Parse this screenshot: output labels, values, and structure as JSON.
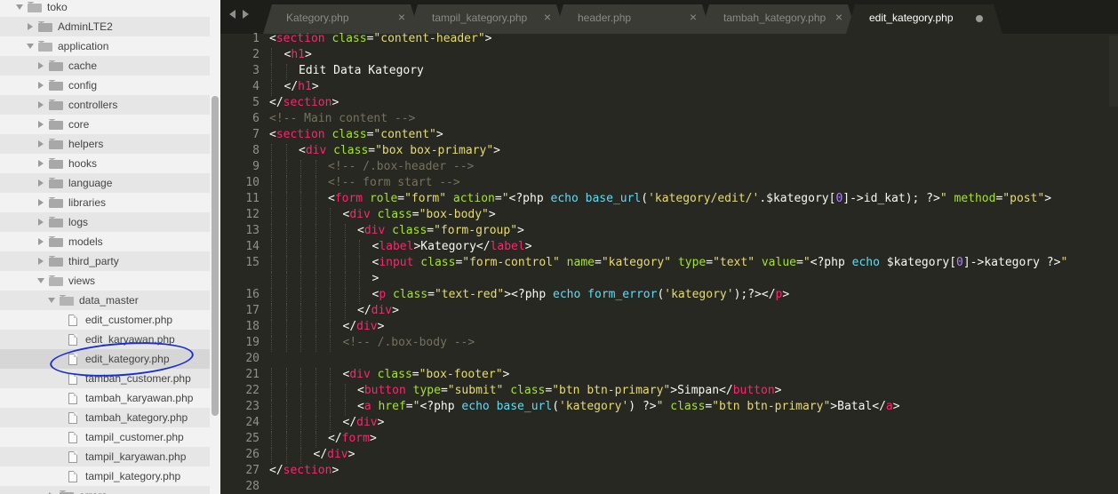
{
  "sidebar": {
    "items": [
      {
        "label": "toko",
        "depth": 0,
        "kind": "folder",
        "state": "open"
      },
      {
        "label": "AdminLTE2",
        "depth": 1,
        "kind": "folder",
        "state": "closed"
      },
      {
        "label": "application",
        "depth": 1,
        "kind": "folder",
        "state": "open"
      },
      {
        "label": "cache",
        "depth": 2,
        "kind": "folder",
        "state": "closed"
      },
      {
        "label": "config",
        "depth": 2,
        "kind": "folder",
        "state": "closed"
      },
      {
        "label": "controllers",
        "depth": 2,
        "kind": "folder",
        "state": "closed"
      },
      {
        "label": "core",
        "depth": 2,
        "kind": "folder",
        "state": "closed"
      },
      {
        "label": "helpers",
        "depth": 2,
        "kind": "folder",
        "state": "closed"
      },
      {
        "label": "hooks",
        "depth": 2,
        "kind": "folder",
        "state": "closed"
      },
      {
        "label": "language",
        "depth": 2,
        "kind": "folder",
        "state": "closed"
      },
      {
        "label": "libraries",
        "depth": 2,
        "kind": "folder",
        "state": "closed"
      },
      {
        "label": "logs",
        "depth": 2,
        "kind": "folder",
        "state": "closed"
      },
      {
        "label": "models",
        "depth": 2,
        "kind": "folder",
        "state": "closed"
      },
      {
        "label": "third_party",
        "depth": 2,
        "kind": "folder",
        "state": "closed"
      },
      {
        "label": "views",
        "depth": 2,
        "kind": "folder",
        "state": "open"
      },
      {
        "label": "data_master",
        "depth": 3,
        "kind": "folder",
        "state": "open"
      },
      {
        "label": "edit_customer.php",
        "depth": 4,
        "kind": "file"
      },
      {
        "label": "edit_karyawan.php",
        "depth": 4,
        "kind": "file"
      },
      {
        "label": "edit_kategory.php",
        "depth": 4,
        "kind": "file",
        "selected": true
      },
      {
        "label": "tambah_customer.php",
        "depth": 4,
        "kind": "file"
      },
      {
        "label": "tambah_karyawan.php",
        "depth": 4,
        "kind": "file"
      },
      {
        "label": "tambah_kategory.php",
        "depth": 4,
        "kind": "file"
      },
      {
        "label": "tampil_customer.php",
        "depth": 4,
        "kind": "file"
      },
      {
        "label": "tampil_karyawan.php",
        "depth": 4,
        "kind": "file"
      },
      {
        "label": "tampil_kategory.php",
        "depth": 4,
        "kind": "file"
      },
      {
        "label": "errors",
        "depth": 3,
        "kind": "folder",
        "state": "closed"
      }
    ]
  },
  "tabs": [
    {
      "label": "Kategory.php",
      "active": false,
      "close": "×"
    },
    {
      "label": "tampil_kategory.php",
      "active": false,
      "close": "×"
    },
    {
      "label": "header.php",
      "active": false,
      "close": "×"
    },
    {
      "label": "tambah_kategory.php",
      "active": false,
      "close": "×"
    },
    {
      "label": "edit_kategory.php",
      "active": true,
      "modified": true
    }
  ],
  "annotation_color": "#1a2fd0",
  "editor": {
    "theme_colors": {
      "tag": "#f92672",
      "attr": "#a6e22e",
      "string": "#e6db74",
      "comment": "#75715e",
      "keyword": "#66d9ef",
      "number": "#ae81ff",
      "text": "#f8f8f2",
      "background": "#272822"
    },
    "lines": [
      {
        "n": "1",
        "indent": 0,
        "tokens": [
          [
            "p",
            "<"
          ],
          [
            "t",
            "section"
          ],
          [
            "p",
            " "
          ],
          [
            "a",
            "class"
          ],
          [
            "p",
            "="
          ],
          [
            "s",
            "\"content-header\""
          ],
          [
            "p",
            ">"
          ]
        ]
      },
      {
        "n": "2",
        "indent": 1,
        "tokens": [
          [
            "p",
            "<"
          ],
          [
            "t",
            "h1"
          ],
          [
            "p",
            ">"
          ]
        ]
      },
      {
        "n": "3",
        "indent": 2,
        "tokens": [
          [
            "p",
            "Edit Data Kategory"
          ]
        ]
      },
      {
        "n": "4",
        "indent": 1,
        "tokens": [
          [
            "p",
            "</"
          ],
          [
            "t",
            "h1"
          ],
          [
            "p",
            ">"
          ]
        ]
      },
      {
        "n": "5",
        "indent": 0,
        "tokens": [
          [
            "p",
            "</"
          ],
          [
            "t",
            "section"
          ],
          [
            "p",
            ">"
          ]
        ]
      },
      {
        "n": "6",
        "indent": 0,
        "tokens": [
          [
            "c",
            "<!-- Main content -->"
          ]
        ]
      },
      {
        "n": "7",
        "indent": 0,
        "tokens": [
          [
            "p",
            "<"
          ],
          [
            "t",
            "section"
          ],
          [
            "p",
            " "
          ],
          [
            "a",
            "class"
          ],
          [
            "p",
            "="
          ],
          [
            "s",
            "\"content\""
          ],
          [
            "p",
            ">"
          ]
        ]
      },
      {
        "n": "8",
        "indent": 2,
        "tokens": [
          [
            "p",
            "<"
          ],
          [
            "t",
            "div"
          ],
          [
            "p",
            " "
          ],
          [
            "a",
            "class"
          ],
          [
            "p",
            "="
          ],
          [
            "s",
            "\"box box-primary\""
          ],
          [
            "p",
            ">"
          ]
        ]
      },
      {
        "n": "9",
        "indent": 4,
        "tokens": [
          [
            "c",
            "<!-- /.box-header -->"
          ]
        ]
      },
      {
        "n": "10",
        "indent": 4,
        "tokens": [
          [
            "c",
            "<!-- form start -->"
          ]
        ]
      },
      {
        "n": "11",
        "indent": 4,
        "tokens": [
          [
            "p",
            "<"
          ],
          [
            "t",
            "form"
          ],
          [
            "p",
            " "
          ],
          [
            "a",
            "role"
          ],
          [
            "p",
            "="
          ],
          [
            "s",
            "\"form\""
          ],
          [
            "p",
            " "
          ],
          [
            "a",
            "action"
          ],
          [
            "p",
            "="
          ],
          [
            "s",
            "\""
          ],
          [
            "p",
            "<?php "
          ],
          [
            "k",
            "echo"
          ],
          [
            "p",
            " "
          ],
          [
            "k",
            "base_url"
          ],
          [
            "p",
            "("
          ],
          [
            "s",
            "'kategory/edit/'"
          ],
          [
            "p",
            "."
          ],
          [
            "p",
            "$kategory"
          ],
          [
            "p",
            "["
          ],
          [
            "n",
            "0"
          ],
          [
            "p",
            "]->id_kat); ?>"
          ],
          [
            "s",
            "\""
          ],
          [
            "p",
            " "
          ],
          [
            "a",
            "method"
          ],
          [
            "p",
            "="
          ],
          [
            "s",
            "\"post\""
          ],
          [
            "p",
            ">"
          ]
        ]
      },
      {
        "n": "12",
        "indent": 5,
        "tokens": [
          [
            "p",
            "<"
          ],
          [
            "t",
            "div"
          ],
          [
            "p",
            " "
          ],
          [
            "a",
            "class"
          ],
          [
            "p",
            "="
          ],
          [
            "s",
            "\"box-body\""
          ],
          [
            "p",
            ">"
          ]
        ]
      },
      {
        "n": "13",
        "indent": 6,
        "tokens": [
          [
            "p",
            "<"
          ],
          [
            "t",
            "div"
          ],
          [
            "p",
            " "
          ],
          [
            "a",
            "class"
          ],
          [
            "p",
            "="
          ],
          [
            "s",
            "\"form-group\""
          ],
          [
            "p",
            ">"
          ]
        ]
      },
      {
        "n": "14",
        "indent": 7,
        "tokens": [
          [
            "p",
            "<"
          ],
          [
            "t",
            "label"
          ],
          [
            "p",
            ">Kategory</"
          ],
          [
            "t",
            "label"
          ],
          [
            "p",
            ">"
          ]
        ]
      },
      {
        "n": "15",
        "indent": 7,
        "tokens": [
          [
            "p",
            "<"
          ],
          [
            "t",
            "input"
          ],
          [
            "p",
            " "
          ],
          [
            "a",
            "class"
          ],
          [
            "p",
            "="
          ],
          [
            "s",
            "\"form-control\""
          ],
          [
            "p",
            " "
          ],
          [
            "a",
            "name"
          ],
          [
            "p",
            "="
          ],
          [
            "s",
            "\"kategory\""
          ],
          [
            "p",
            " "
          ],
          [
            "a",
            "type"
          ],
          [
            "p",
            "="
          ],
          [
            "s",
            "\"text\""
          ],
          [
            "p",
            " "
          ],
          [
            "a",
            "value"
          ],
          [
            "p",
            "="
          ],
          [
            "s",
            "\""
          ],
          [
            "p",
            "<?php "
          ],
          [
            "k",
            "echo"
          ],
          [
            "p",
            " $kategory["
          ],
          [
            "n",
            "0"
          ],
          [
            "p",
            "]->kategory ?>"
          ],
          [
            "s",
            "\""
          ]
        ]
      },
      {
        "n": "",
        "indent": 7,
        "tokens": [
          [
            "p",
            ">"
          ]
        ]
      },
      {
        "n": "16",
        "indent": 7,
        "tokens": [
          [
            "p",
            "<"
          ],
          [
            "t",
            "p"
          ],
          [
            "p",
            " "
          ],
          [
            "a",
            "class"
          ],
          [
            "p",
            "="
          ],
          [
            "s",
            "\"text-red\""
          ],
          [
            "p",
            "><?php "
          ],
          [
            "k",
            "echo"
          ],
          [
            "p",
            " "
          ],
          [
            "k",
            "form_error"
          ],
          [
            "p",
            "("
          ],
          [
            "s",
            "'kategory'"
          ],
          [
            "p",
            ");?></"
          ],
          [
            "t",
            "p"
          ],
          [
            "p",
            ">"
          ]
        ]
      },
      {
        "n": "17",
        "indent": 6,
        "tokens": [
          [
            "p",
            "</"
          ],
          [
            "t",
            "div"
          ],
          [
            "p",
            ">"
          ]
        ]
      },
      {
        "n": "18",
        "indent": 5,
        "tokens": [
          [
            "p",
            "</"
          ],
          [
            "t",
            "div"
          ],
          [
            "p",
            ">"
          ]
        ]
      },
      {
        "n": "19",
        "indent": 5,
        "tokens": [
          [
            "c",
            "<!-- /.box-body -->"
          ]
        ]
      },
      {
        "n": "20",
        "indent": 0,
        "tokens": []
      },
      {
        "n": "21",
        "indent": 5,
        "tokens": [
          [
            "p",
            "<"
          ],
          [
            "t",
            "div"
          ],
          [
            "p",
            " "
          ],
          [
            "a",
            "class"
          ],
          [
            "p",
            "="
          ],
          [
            "s",
            "\"box-footer\""
          ],
          [
            "p",
            ">"
          ]
        ]
      },
      {
        "n": "22",
        "indent": 6,
        "tokens": [
          [
            "p",
            "<"
          ],
          [
            "t",
            "button"
          ],
          [
            "p",
            " "
          ],
          [
            "a",
            "type"
          ],
          [
            "p",
            "="
          ],
          [
            "s",
            "\"submit\""
          ],
          [
            "p",
            " "
          ],
          [
            "a",
            "class"
          ],
          [
            "p",
            "="
          ],
          [
            "s",
            "\"btn btn-primary\""
          ],
          [
            "p",
            ">Simpan</"
          ],
          [
            "t",
            "button"
          ],
          [
            "p",
            ">"
          ]
        ]
      },
      {
        "n": "23",
        "indent": 6,
        "tokens": [
          [
            "p",
            "<"
          ],
          [
            "t",
            "a"
          ],
          [
            "p",
            " "
          ],
          [
            "a",
            "href"
          ],
          [
            "p",
            "="
          ],
          [
            "s",
            "\""
          ],
          [
            "p",
            "<?php "
          ],
          [
            "k",
            "echo"
          ],
          [
            "p",
            " "
          ],
          [
            "k",
            "base_url"
          ],
          [
            "p",
            "("
          ],
          [
            "s",
            "'kategory'"
          ],
          [
            "p",
            ") ?>"
          ],
          [
            "s",
            "\""
          ],
          [
            "p",
            " "
          ],
          [
            "a",
            "class"
          ],
          [
            "p",
            "="
          ],
          [
            "s",
            "\"btn btn-primary\""
          ],
          [
            "p",
            ">Batal</"
          ],
          [
            "t",
            "a"
          ],
          [
            "p",
            ">"
          ]
        ]
      },
      {
        "n": "24",
        "indent": 5,
        "tokens": [
          [
            "p",
            "</"
          ],
          [
            "t",
            "div"
          ],
          [
            "p",
            ">"
          ]
        ]
      },
      {
        "n": "25",
        "indent": 4,
        "tokens": [
          [
            "p",
            "</"
          ],
          [
            "t",
            "form"
          ],
          [
            "p",
            ">"
          ]
        ]
      },
      {
        "n": "26",
        "indent": 3,
        "tokens": [
          [
            "p",
            "</"
          ],
          [
            "t",
            "div"
          ],
          [
            "p",
            ">"
          ]
        ]
      },
      {
        "n": "27",
        "indent": 0,
        "tokens": [
          [
            "p",
            "</"
          ],
          [
            "t",
            "section"
          ],
          [
            "p",
            ">"
          ]
        ]
      },
      {
        "n": "28",
        "indent": 0,
        "tokens": []
      }
    ]
  }
}
